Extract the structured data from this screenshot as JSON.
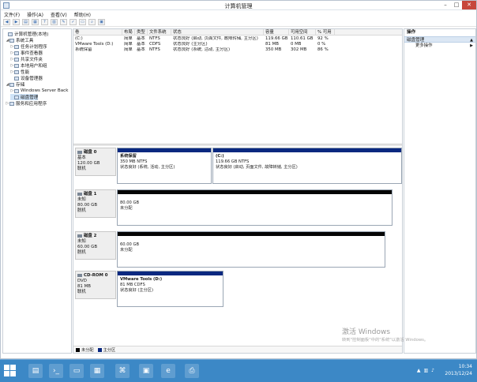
{
  "window": {
    "title": "计算机管理"
  },
  "menu": [
    "文件(F)",
    "操作(A)",
    "查看(V)",
    "帮助(H)"
  ],
  "tree": {
    "items": [
      {
        "label": "计算机管理(本地)",
        "level": 0,
        "twisty": "",
        "selected": false
      },
      {
        "label": "系统工具",
        "level": 1,
        "twisty": "◢",
        "selected": false
      },
      {
        "label": "任务计划程序",
        "level": 2,
        "twisty": "▷",
        "selected": false
      },
      {
        "label": "事件查看器",
        "level": 2,
        "twisty": "▷",
        "selected": false
      },
      {
        "label": "共享文件夹",
        "level": 2,
        "twisty": "▷",
        "selected": false
      },
      {
        "label": "本地用户和组",
        "level": 2,
        "twisty": "▷",
        "selected": false
      },
      {
        "label": "性能",
        "level": 2,
        "twisty": "▷",
        "selected": false
      },
      {
        "label": "设备管理器",
        "level": 2,
        "twisty": "",
        "selected": false
      },
      {
        "label": "存储",
        "level": 1,
        "twisty": "◢",
        "selected": false
      },
      {
        "label": "Windows Server Back",
        "level": 2,
        "twisty": "▷",
        "selected": false
      },
      {
        "label": "磁盘管理",
        "level": 2,
        "twisty": "",
        "selected": true
      },
      {
        "label": "服务和应用程序",
        "level": 1,
        "twisty": "▷",
        "selected": false
      }
    ]
  },
  "volumes": {
    "headers": [
      "卷",
      "布局",
      "类型",
      "文件系统",
      "状态",
      "容量",
      "可用空间",
      "% 可用"
    ],
    "rows": [
      [
        "(C:)",
        "简单",
        "基本",
        "NTFS",
        "状态良好 (启动, 页面文件, 故障转储, 主分区)",
        "119.66 GB",
        "110.61 GB",
        "92 %"
      ],
      [
        "VMware Tools (D:)",
        "简单",
        "基本",
        "CDFS",
        "状态良好 (主分区)",
        "81 MB",
        "0 MB",
        "0 %"
      ],
      [
        "系统保留",
        "简单",
        "基本",
        "NTFS",
        "状态良好 (系统, 活动, 主分区)",
        "350 MB",
        "302 MB",
        "86 %"
      ]
    ]
  },
  "disks": [
    {
      "name": "磁盘 0",
      "type": "基本",
      "size": "120.00 GB",
      "status": "联机",
      "partitions": [
        {
          "name": "系统保留",
          "size": "350 MB NTFS",
          "status": "状态良好 (系统, 活动, 主分区)",
          "bar": "blue"
        },
        {
          "name": "(C:)",
          "size": "119.66 GB NTFS",
          "status": "状态良好 (启动, 页面文件, 故障转储, 主分区)",
          "bar": "blue"
        }
      ]
    },
    {
      "name": "磁盘 1",
      "type": "未知",
      "size": "80.00 GB",
      "status": "脱机",
      "partitions": [
        {
          "name": "",
          "size": "80.00 GB",
          "status": "未分配",
          "bar": "black"
        }
      ]
    },
    {
      "name": "磁盘 2",
      "type": "未知",
      "size": "60.00 GB",
      "status": "脱机",
      "partitions": [
        {
          "name": "",
          "size": "60.00 GB",
          "status": "未分配",
          "bar": "black"
        }
      ]
    },
    {
      "name": "CD-ROM 0",
      "type": "DVD",
      "size": "81 MB",
      "status": "联机",
      "partitions": [
        {
          "name": "VMware Tools  (D:)",
          "size": "81 MB CDFS",
          "status": "状态良好 (主分区)",
          "bar": "blue"
        }
      ]
    }
  ],
  "legend": [
    "未分配",
    "主分区"
  ],
  "actions": {
    "title": "操作",
    "section": "磁盘管理",
    "item": "更多操作"
  },
  "watermark": {
    "line1": "激活 Windows",
    "line2": "转到\"控制面板\"中的\"系统\"以激活 Windows。"
  },
  "clock": {
    "time": "10:34",
    "date": "2013/12/24"
  },
  "colors": {
    "partition_primary": "#0a2880",
    "unallocated": "#050505",
    "taskbar": "#3c88c6"
  }
}
